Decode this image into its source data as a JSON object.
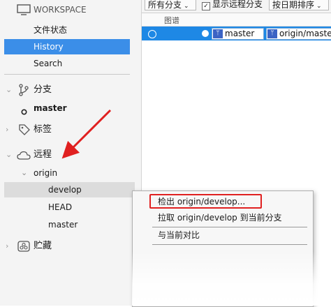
{
  "sidebar": {
    "workspace": {
      "label": "WORKSPACE"
    },
    "workspace_items": [
      {
        "label": "文件状态"
      },
      {
        "label": "History"
      },
      {
        "label": "Search"
      }
    ],
    "branches": {
      "label": "分支",
      "items": [
        {
          "label": "master"
        }
      ]
    },
    "tags": {
      "label": "标签"
    },
    "remotes": {
      "label": "远程",
      "origin": {
        "label": "origin",
        "items": [
          {
            "label": "develop"
          },
          {
            "label": "HEAD"
          },
          {
            "label": "master"
          }
        ]
      }
    },
    "stashes": {
      "label": "贮藏"
    }
  },
  "toolbar": {
    "branches_dropdown": "所有分支",
    "show_remote": {
      "label": "显示远程分支",
      "checked": true
    },
    "sort_dropdown": "按日期排序"
  },
  "graph": {
    "header": "图谱",
    "row": {
      "tags": [
        "master",
        "origin/master"
      ]
    }
  },
  "context_menu": {
    "items": [
      "检出 origin/develop...",
      "拉取 origin/develop 到当前分支",
      "与当前对比"
    ]
  },
  "colors": {
    "selection": "#3b8ee8",
    "row_highlight": "#1e88e5",
    "annotation_red": "#e02020"
  }
}
